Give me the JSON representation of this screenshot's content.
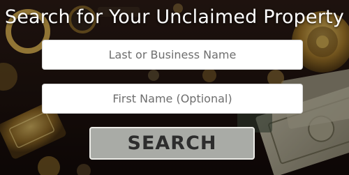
{
  "heading": "Search for Your Unclaimed Property",
  "fields": {
    "last_name_placeholder": "Last or Business Name",
    "first_name_placeholder": "First Name (Optional)"
  },
  "search_button_label": "SEARCH",
  "colors": {
    "button_bg": "#a9aba6",
    "button_border": "#ebebe6",
    "button_text": "#2d2d2d",
    "heading_text": "#ffffff"
  }
}
